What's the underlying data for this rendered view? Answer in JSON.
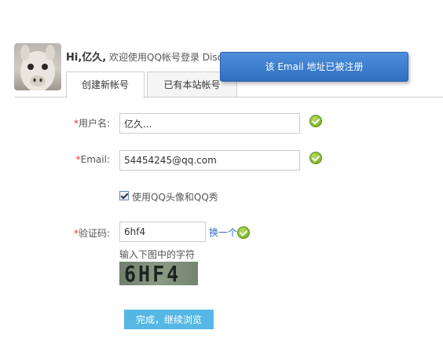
{
  "header": {
    "user_name": "Hi,亿久,",
    "welcome": "欢迎使用QQ帐号登录 Disc"
  },
  "tabs": [
    {
      "label": "创建新帐号",
      "active": true
    },
    {
      "label": "已有本站帐号",
      "active": false
    }
  ],
  "toast": {
    "message": "该 Email 地址已被注册"
  },
  "form": {
    "username": {
      "label": "用户名:",
      "required_mark": "*",
      "value": "亿久..."
    },
    "email": {
      "label": "Email:",
      "required_mark": "*",
      "value": "54454245@qq.com"
    },
    "use_qq_avatar": {
      "label": "使用QQ头像和QQ秀",
      "checked": true
    },
    "captcha": {
      "label": "验证码:",
      "required_mark": "*",
      "value": "6hf4",
      "refresh_label": "换一个",
      "hint": "输入下图中的字符",
      "image_text": "6HF4"
    }
  },
  "submit": {
    "label": "完成，继续浏览"
  },
  "colors": {
    "toast_bg": "#3a7bd0",
    "submit_bg": "#56b7e4",
    "ok_icon": "#7fb52a",
    "required": "#ee3333",
    "link": "#2b6cc4"
  }
}
